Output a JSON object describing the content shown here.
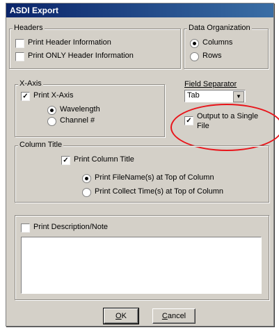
{
  "dialog": {
    "title": "ASDI Export"
  },
  "headers": {
    "legend": "Headers",
    "print_header": {
      "label": "Print Header Information",
      "checked": false
    },
    "print_only_header": {
      "label": "Print ONLY Header Information",
      "checked": false
    }
  },
  "data_org": {
    "legend": "Data Organization",
    "columns": {
      "label": "Columns",
      "selected": true
    },
    "rows": {
      "label": "Rows",
      "selected": false
    }
  },
  "xaxis": {
    "legend": "X-Axis",
    "print_xaxis": {
      "label": "Print X-Axis",
      "checked": true
    },
    "wavelength": {
      "label": "Wavelength",
      "selected": true
    },
    "channel": {
      "label": "Channel #",
      "selected": false
    }
  },
  "field_sep": {
    "label": "Field Separator",
    "value": "Tab"
  },
  "output_single": {
    "label_line1": "Output to a Single",
    "label_line2": "File",
    "checked": true
  },
  "column_title": {
    "legend": "Column Title",
    "print_title": {
      "label": "Print Column Title",
      "checked": true
    },
    "filename_top": {
      "label": "Print FileName(s) at Top of Column",
      "selected": true
    },
    "collect_time_top": {
      "label": "Print Collect Time(s) at Top of Column",
      "selected": false
    }
  },
  "description": {
    "print_desc": {
      "label": "Print Description/Note",
      "checked": false
    },
    "text": ""
  },
  "buttons": {
    "ok": "OK",
    "cancel": "Cancel"
  },
  "check_mark": "✓",
  "highlight_color": "#e8141a"
}
